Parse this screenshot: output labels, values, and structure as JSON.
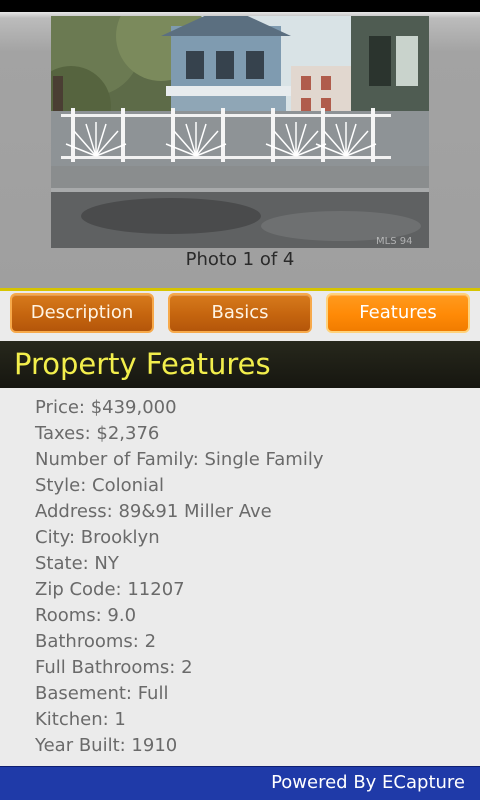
{
  "photo": {
    "caption": "Photo 1 of 4",
    "watermark": "MLS 94"
  },
  "tabs": [
    {
      "label": "Description",
      "active": false
    },
    {
      "label": "Basics",
      "active": false
    },
    {
      "label": "Features",
      "active": true
    }
  ],
  "section": {
    "title": "Property Features"
  },
  "features": [
    "Price: $439,000",
    "Taxes: $2,376",
    "Number of Family: Single Family",
    "Style: Colonial",
    "Address: 89&91 Miller Ave",
    "City: Brooklyn",
    "State: NY",
    "Zip Code: 11207",
    "Rooms: 9.0",
    "Bathrooms: 2",
    "Full Bathrooms: 2",
    "Basement: Full",
    "Kitchen: 1",
    "Year Built: 1910"
  ],
  "footer": {
    "text": "Powered By ECapture"
  },
  "colors": {
    "tab_active": "#ff8a06",
    "tab_inactive": "#c5650f",
    "section_title": "#f2ee4c",
    "footer_bg": "#1f3aa8"
  }
}
